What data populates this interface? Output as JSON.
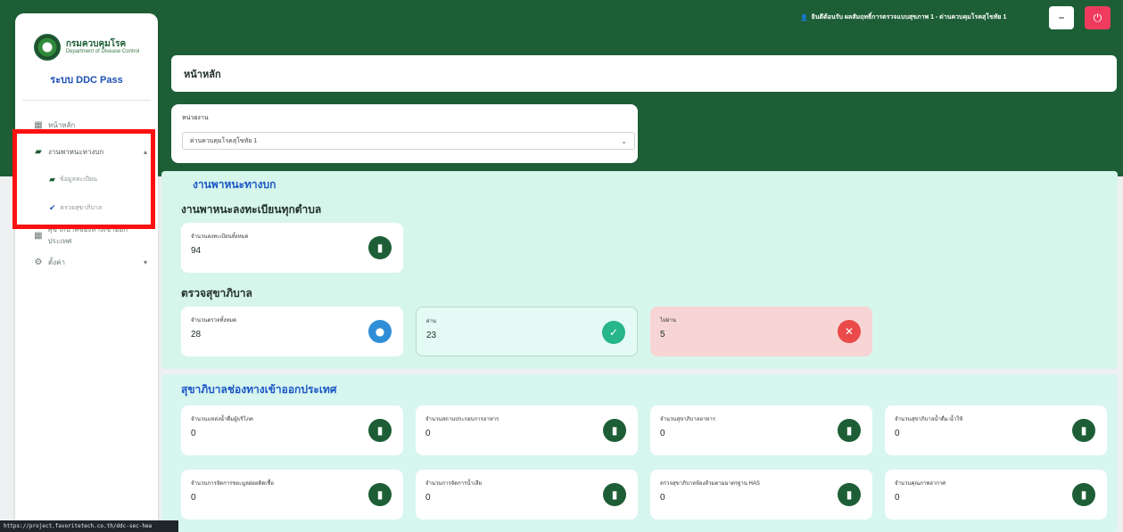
{
  "app": {
    "logo_text": "กรมควบคุมโรค",
    "logo_sub": "Department of Disease Control",
    "title": "ระบบ DDC Pass"
  },
  "topbar": {
    "user_text": "ยินดีต้อนรับ ผลสัมฤทธิ์การตรวจแบบสุขภาพ 1 - ด่านควบคุมโรคสุโขทัย 1",
    "minimize_icon": "minus-icon",
    "power_icon": "power-icon",
    "power_color": "#ee3b5e"
  },
  "sidebar": {
    "items": [
      {
        "label": "หน้าหลัก",
        "icon": "grid-icon"
      },
      {
        "label": "งานพาหนะทางบก",
        "icon": "truck-icon",
        "expanded": true,
        "children": [
          {
            "label": "ข้อมูลทะเบียน",
            "icon": "truck-icon"
          },
          {
            "label": "ตรวจสุขาภิบาล",
            "icon": "check-icon"
          }
        ]
      },
      {
        "label": "สุขาภิบาลช่องทางเข้าออกประเทศ",
        "icon": "grid-icon"
      },
      {
        "label": "ตั้งค่า",
        "icon": "gear-icon"
      }
    ]
  },
  "page": {
    "title": "หน้าหลัก"
  },
  "filter": {
    "label": "หน่วยงาน",
    "value": "ด่านควบคุมโรคสุโขทัย 1"
  },
  "land_vehicle": {
    "title": "งานพาหนะทางบก",
    "registry_title": "งานพาหนะลงทะเบียนทุกตำบล",
    "registry_card": {
      "label": "จำนวนลงทะเบียนทั้งหมด",
      "value": "94"
    },
    "inspection_title": "ตรวจสุขาภิบาล",
    "inspection_cards": [
      {
        "label": "จำนวนตรวจทั้งหมด",
        "value": "28",
        "icon": "info-icon"
      },
      {
        "label": "ผ่าน",
        "value": "23",
        "icon": "check-icon"
      },
      {
        "label": "ไม่ผ่าน",
        "value": "5",
        "icon": "x-icon"
      }
    ]
  },
  "border_sanitation": {
    "title": "สุขาภิบาลช่องทางเข้าออกประเทศ",
    "cards": [
      {
        "label": "จำนวนแหล่งน้ำดื่มผู้บริโภค",
        "value": "0"
      },
      {
        "label": "จำนวนสถานประกอบการอาหาร",
        "value": "0"
      },
      {
        "label": "จำนวนสุขาภิบาลอาหาร",
        "value": "0"
      },
      {
        "label": "จำนวนสุขาภิบาลน้ำดื่ม-น้ำใช้",
        "value": "0"
      },
      {
        "label": "จำนวนการจัดการขยะมูลฝอยติดเชื้อ",
        "value": "0"
      },
      {
        "label": "จำนวนการจัดการน้ำเสีย",
        "value": "0"
      },
      {
        "label": "ตรวจสุขาภิบาลห้องส้วมตามมาตรฐาน HAS",
        "value": "0"
      },
      {
        "label": "จำนวนคุณภาพอากาศ",
        "value": "0"
      }
    ]
  },
  "statusbar": {
    "url": "https://project.favoritetech.co.th/ddc-sec-hea"
  }
}
